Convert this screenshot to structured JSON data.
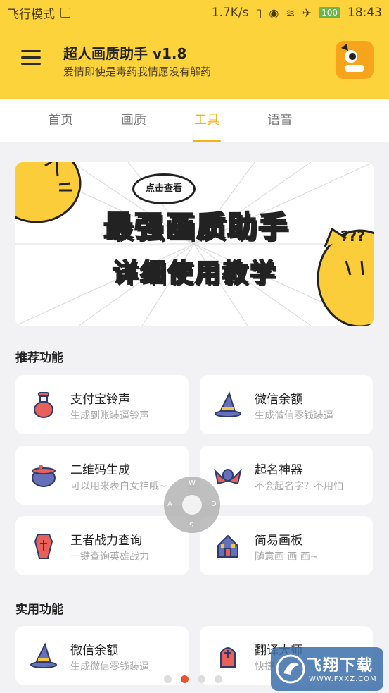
{
  "status_bar": {
    "airplane_mode": "飞行模式",
    "speed": "1.7K/s",
    "battery": "100",
    "time": "18:43"
  },
  "app_bar": {
    "title": "超人画质助手 v1.8",
    "subtitle": "爱情即使是毒药我情愿没有解药"
  },
  "tabs": [
    {
      "label": "首页"
    },
    {
      "label": "画质"
    },
    {
      "label": "工具",
      "active": true
    },
    {
      "label": "语音"
    }
  ],
  "banner": {
    "bubble": "点击查看",
    "line1": "最强画质助手",
    "line2": "详细使用教学"
  },
  "sections": {
    "recommended": {
      "title": "推荐功能",
      "items": [
        {
          "title": "支付宝铃声",
          "subtitle": "生成到账装逼铃声",
          "icon": "potion-icon"
        },
        {
          "title": "微信余额",
          "subtitle": "生成微信零钱装逼",
          "icon": "wizard-hat-icon"
        },
        {
          "title": "二维码生成",
          "subtitle": "可以用来表白女神哦~",
          "icon": "cauldron-icon"
        },
        {
          "title": "起名神器",
          "subtitle": "不会起名字？不用怕",
          "icon": "bat-icon"
        },
        {
          "title": "王者战力查询",
          "subtitle": "一键查询英雄战力",
          "icon": "coffin-icon"
        },
        {
          "title": "简易画板",
          "subtitle": "随意画 画 画~",
          "icon": "haunted-house-icon"
        }
      ]
    },
    "practical": {
      "title": "实用功能",
      "items": [
        {
          "title": "微信余额",
          "subtitle": "生成微信零钱装逼",
          "icon": "wizard-hat-icon"
        },
        {
          "title": "翻译大师",
          "subtitle": "快捷",
          "icon": "tombstone-icon"
        }
      ]
    }
  },
  "joystick": {
    "up": "W",
    "left": "A",
    "right": "D",
    "down": "S"
  },
  "watermark": {
    "line1": "飞翔下载",
    "line2": "WWW.FXXZ.COM"
  },
  "colors": {
    "brand_yellow": "#fcd33a",
    "active_tab": "#f4b416",
    "page_bg": "#f2f2f4",
    "active_dot": "#e4572e"
  }
}
